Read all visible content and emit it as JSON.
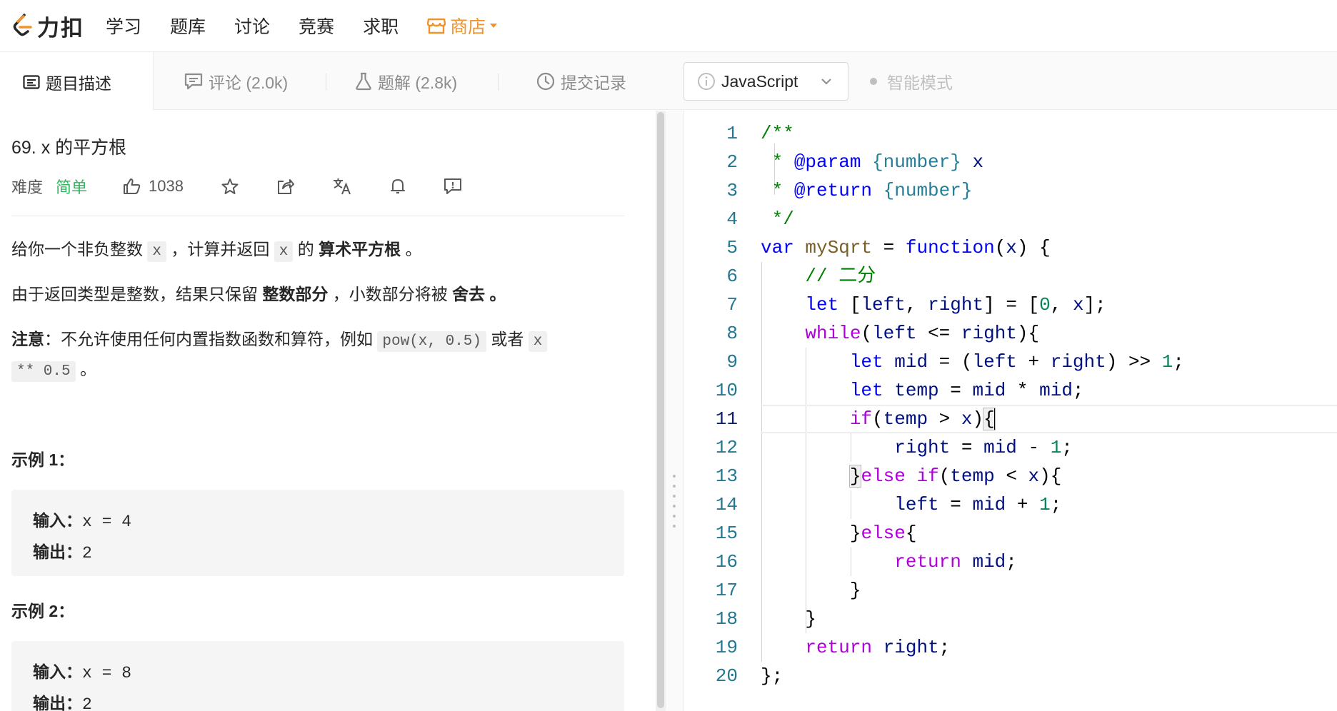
{
  "nav": {
    "logo_text": "力扣",
    "items": [
      "学习",
      "题库",
      "讨论",
      "竞赛",
      "求职"
    ],
    "shop": "商店"
  },
  "tabs": {
    "description": "题目描述",
    "comments": "评论 (2.0k)",
    "solutions": "题解 (2.8k)",
    "submissions": "提交记录"
  },
  "editor_bar": {
    "language": "JavaScript",
    "smart_mode": "智能模式"
  },
  "problem": {
    "title": "69. x 的平方根",
    "difficulty_label": "难度",
    "difficulty": "简单",
    "likes": "1038",
    "p1_a": "给你一个非负整数 ",
    "p1_code1": "x",
    "p1_b": " ，计算并返回 ",
    "p1_code2": "x",
    "p1_c": " 的 ",
    "p1_bold": "算术平方根",
    "p1_d": " 。",
    "p2_a": "由于返回类型是整数，结果只保留 ",
    "p2_bold1": "整数部分",
    "p2_b": " ，小数部分将被 ",
    "p2_bold2": "舍去",
    "p2_c": " 。",
    "note_label": "注意",
    "note_text": "：不允许使用任何内置指数函数和算符，例如 ",
    "note_code1": "pow(x, 0.5)",
    "note_mid": " 或者 ",
    "note_code2a": "x",
    "note_code2b": "** 0.5",
    "note_end": " 。",
    "example1_title": "示例 1：",
    "example1_input_label": "输入：",
    "example1_input": "x = 4",
    "example1_output_label": "输出：",
    "example1_output": "2",
    "example2_title": "示例 2：",
    "example2_input_label": "输入：",
    "example2_input": "x = 8",
    "example2_output_label": "输出：",
    "example2_output": "2"
  },
  "code": {
    "line_numbers": [
      "1",
      "2",
      "3",
      "4",
      "5",
      "6",
      "7",
      "8",
      "9",
      "10",
      "11",
      "12",
      "13",
      "14",
      "15",
      "16",
      "17",
      "18",
      "19",
      "20"
    ],
    "current_line": 11
  }
}
